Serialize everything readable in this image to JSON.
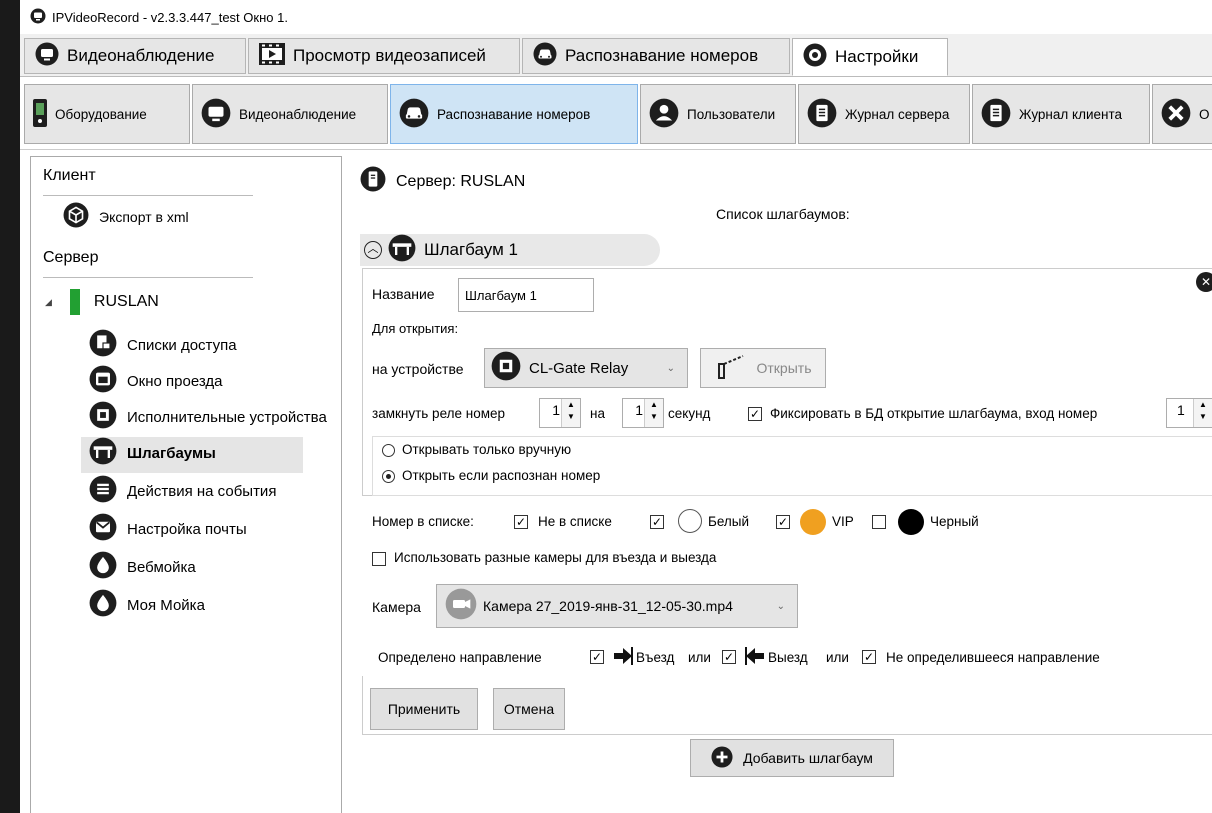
{
  "window": {
    "title": "IPVideoRecord - v2.3.3.447_test Окно 1."
  },
  "main_tabs": [
    {
      "label": "Видеонаблюдение",
      "icon": "monitor-icon"
    },
    {
      "label": "Просмотр видеозаписей",
      "icon": "film-icon"
    },
    {
      "label": "Распознавание номеров",
      "icon": "car-icon"
    },
    {
      "label": "Настройки",
      "icon": "gear-icon"
    }
  ],
  "sub_tabs": [
    {
      "label": "Оборудование"
    },
    {
      "label": "Видеонаблюдение"
    },
    {
      "label": "Распознавание номеров"
    },
    {
      "label": "Пользователи"
    },
    {
      "label": "Журнал сервера"
    },
    {
      "label": "Журнал клиента"
    },
    {
      "label": "О"
    }
  ],
  "sidebar": {
    "client_header": "Клиент",
    "export_label": "Экспорт в xml",
    "server_header": "Сервер",
    "server_name": "RUSLAN",
    "items": [
      {
        "label": "Списки доступа"
      },
      {
        "label": "Окно проезда"
      },
      {
        "label": "Исполнительные устройства"
      },
      {
        "label": "Шлагбаумы"
      },
      {
        "label": "Действия на события"
      },
      {
        "label": "Настройка почты"
      },
      {
        "label": "Вебмойка"
      },
      {
        "label": "Моя Мойка"
      }
    ]
  },
  "content": {
    "server_title": "Сервер: RUSLAN",
    "list_title": "Список шлагбаумов:",
    "barrier_title": "Шлагбаум 1",
    "name_label": "Название",
    "name_value": "Шлагбаум 1",
    "open_label": "Для открытия:",
    "device_label": "на устройстве",
    "device_value": "CL-Gate Relay",
    "open_button": "Открыть",
    "relay_label": "замкнуть реле номер",
    "relay_value": "1",
    "on_label": "на",
    "seconds_value": "1",
    "seconds_label": "секунд",
    "fix_label": "Фиксировать в БД открытие шлагбаума, вход номер",
    "input_number_value": "1",
    "radio_manual": "Открывать только вручную",
    "radio_auto": "Открыть если распознан номер",
    "number_in_list_label": "Номер в списке:",
    "not_in_list": "Не в списке",
    "white": "Белый",
    "vip": "VIP",
    "black": "Черный",
    "diff_cameras": "Использовать разные камеры для въезда и выезда",
    "camera_label": "Камера",
    "camera_value": "Камера 27_2019-янв-31_12-05-30.mp4",
    "direction_label": "Определено направление",
    "entry": "Въезд",
    "or1": "или",
    "exit": "Выезд",
    "or2": "или",
    "undetermined": "Не определившееся направление",
    "apply_button": "Применить",
    "cancel_button": "Отмена",
    "add_button": "Добавить шлагбаум"
  },
  "colors": {
    "active_subtab": "#cfe4f5",
    "vip": "#f0a020"
  }
}
